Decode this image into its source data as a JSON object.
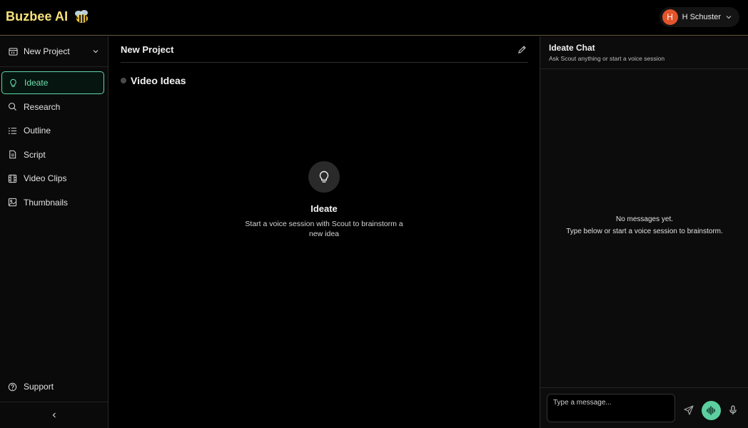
{
  "app": {
    "brand": "Buzbee AI",
    "colors": {
      "accent": "#5fd6a7",
      "brand": "#f6e27a",
      "avatar": "#e2542b"
    }
  },
  "user": {
    "initial": "H",
    "name": "H Schuster"
  },
  "sidebar": {
    "project_label": "New Project",
    "items": [
      {
        "label": "Ideate",
        "icon": "lightbulb-icon",
        "active": true
      },
      {
        "label": "Research",
        "icon": "search-icon"
      },
      {
        "label": "Outline",
        "icon": "list-icon"
      },
      {
        "label": "Script",
        "icon": "document-icon"
      },
      {
        "label": "Video Clips",
        "icon": "film-icon"
      },
      {
        "label": "Thumbnails",
        "icon": "image-icon"
      }
    ],
    "support_label": "Support"
  },
  "main": {
    "title": "New Project",
    "section_title": "Video Ideas",
    "empty_title": "Ideate",
    "empty_text": "Start a voice session with Scout to brainstorm a new idea"
  },
  "chat": {
    "title": "Ideate Chat",
    "subtitle": "Ask Scout anything or start a voice session",
    "empty_line1": "No messages yet.",
    "empty_line2": "Type below or start a voice session to brainstorm.",
    "input_placeholder": "Type a message..."
  }
}
